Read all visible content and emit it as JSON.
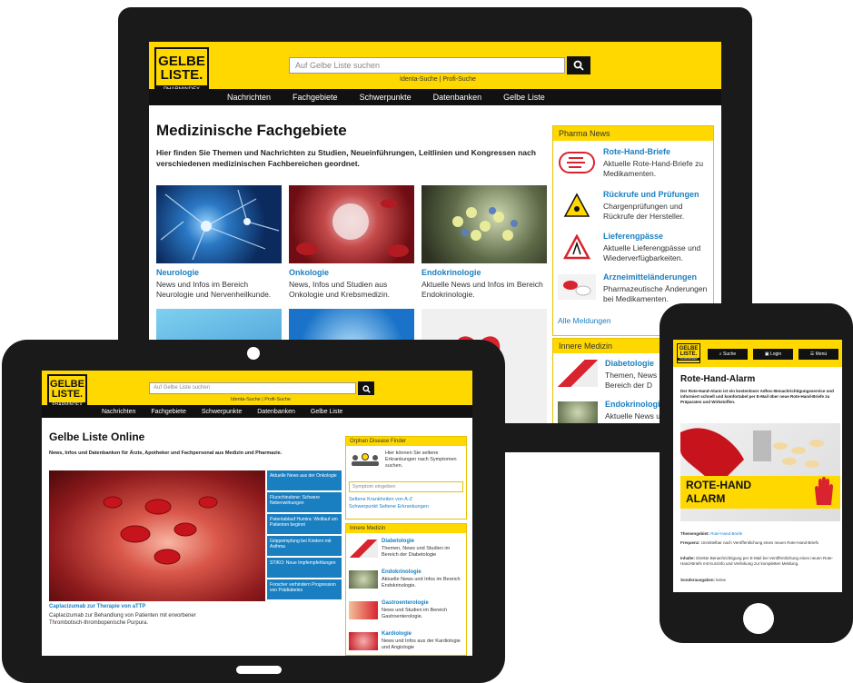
{
  "desktop": {
    "logo": {
      "line1": "GELBE",
      "line2": "LISTE.",
      "sub": "PHARMINDEX"
    },
    "search": {
      "placeholder": "Auf Gelbe Liste suchen",
      "links": "Identa-Suche | Profi-Suche"
    },
    "nav": [
      "Nachrichten",
      "Fachgebiete",
      "Schwerpunkte",
      "Datenbanken",
      "Gelbe Liste"
    ],
    "title": "Medizinische Fachgebiete",
    "intro": "Hier finden Sie Themen und Nachrichten zu Studien, Neueinführungen, Leitlinien und Kongressen nach verschiedenen medizinischen Fachbereichen geordnet.",
    "cards": [
      {
        "title": "Neurologie",
        "text": "News und Infos im Bereich Neurologie und Nervenheilkunde."
      },
      {
        "title": "Onkologie",
        "text": "News, Infos und Studien aus Onkologie und Krebsmedizin."
      },
      {
        "title": "Endokrinologie",
        "text": "Aktuelle News und Infos im Bereich Endokrinologie."
      }
    ],
    "pharma_news": {
      "header": "Pharma News",
      "items": [
        {
          "title": "Rote-Hand-Briefe",
          "text": "Aktuelle Rote-Hand-Briefe zu Medikamenten."
        },
        {
          "title": "Rückrufe und Prüfungen",
          "text": "Chargenprüfungen und Rückrufe der Hersteller."
        },
        {
          "title": "Lieferengpässe",
          "text": "Aktuelle Lieferengpässe und Wiederverfügbarkeiten."
        },
        {
          "title": "Arzneimitteländerungen",
          "text": "Pharmazeutische Änderungen bei Medikamenten."
        }
      ],
      "all": "Alle Meldungen"
    },
    "innere": {
      "header": "Innere Medizin",
      "items": [
        {
          "title": "Diabetologie",
          "text": "Themen, News u im Bereich der D"
        },
        {
          "title": "Endokrinologie",
          "text": "Aktuelle News u"
        }
      ]
    }
  },
  "tablet": {
    "logo": {
      "line1": "GELBE",
      "line2": "LISTE.",
      "sub": "PHARMINDEX"
    },
    "search": {
      "placeholder": "Auf Gelbe Liste suchen",
      "links": "Identa-Suche | Profi-Suche"
    },
    "nav": [
      "Nachrichten",
      "Fachgebiete",
      "Schwerpunkte",
      "Datenbanken",
      "Gelbe Liste"
    ],
    "title": "Gelbe Liste Online",
    "intro": "News, Infos und Datenbanken für Ärzte, Apotheker und Fachpersonal aus Medizin und Pharmazie.",
    "hero_caption": "Caplacizumab zur Therapie von aTTP",
    "hero_text": "Caplacizumab zur Behandlung von Patienten mit erworbener Thrombotisch-thrombopenische Purpura.",
    "news_list": [
      "Aktuelle News aus der Onkologie",
      "Fluorchinolone: Schwere Nebenwirkungen",
      "Patentablauf Humira: Weitlauf um Patienten beginnt",
      "Grippeimpfung bei Kindern mit Asthma",
      "STIKO: Neue Impfempfehlungen",
      "Forscher verhindern Progression von Prädiabetes"
    ],
    "orphan": {
      "header": "Orphan Disease Finder",
      "text": "Hier können Sie seltene Erkrankungen nach Symptomen suchen.",
      "placeholder": "Symptom eingeben",
      "link1": "Seltene Krankheiten von A-Z",
      "link2": "Schwerpunkt Seltene Erkrankungen"
    },
    "innere": {
      "header": "Innere Medizin",
      "items": [
        {
          "title": "Diabetologie",
          "text": "Themen, News und Studien im Bereich der Diabetologie"
        },
        {
          "title": "Endokrinologie",
          "text": "Aktuelle News und Infos im Bereich Endokrinologie."
        },
        {
          "title": "Gastroenterologie",
          "text": "News und Studien im Bereich Gastroenterologie."
        },
        {
          "title": "Kardiologie",
          "text": "News und Infos aus der Kardiologie und Angiologie"
        }
      ]
    }
  },
  "phone": {
    "logo": {
      "line1": "GELBE",
      "line2": "LISTE.",
      "sub": "PHARMINDEX"
    },
    "buttons": [
      "Suche",
      "Login",
      "Menü"
    ],
    "title": "Rote-Hand-Alarm",
    "intro": "Der Rote-Hand-Alarm ist ein kostenloser Adhoc-Benachrichtigungsservice und informiert schnell und komfortabel per E-Mail über neue Rote-Hand-Briefe zu Präparaten und Wirkstoffen.",
    "banner": "ROTE-HAND ALARM",
    "meta": [
      {
        "label": "Themengebiet:",
        "value": "Rote-Hand-Briefe"
      },
      {
        "label": "Frequenz:",
        "value": "Unmittelbar nach Veröffentlichung eines neuen Rote-Hand-Briefs"
      },
      {
        "label": "Inhalte:",
        "value": "Direkte Benachrichtigung per E-Mail bei Veröffentlichung eines neuen Rote-Hand-Briefs mit Kurzinfo und Verlinkung zur kompletten Meldung."
      },
      {
        "label": "Sonderausgaben:",
        "value": "keine"
      }
    ]
  },
  "colors": {
    "yellow": "#ffd800",
    "link": "#1a7fc1",
    "nav": "#111111"
  }
}
